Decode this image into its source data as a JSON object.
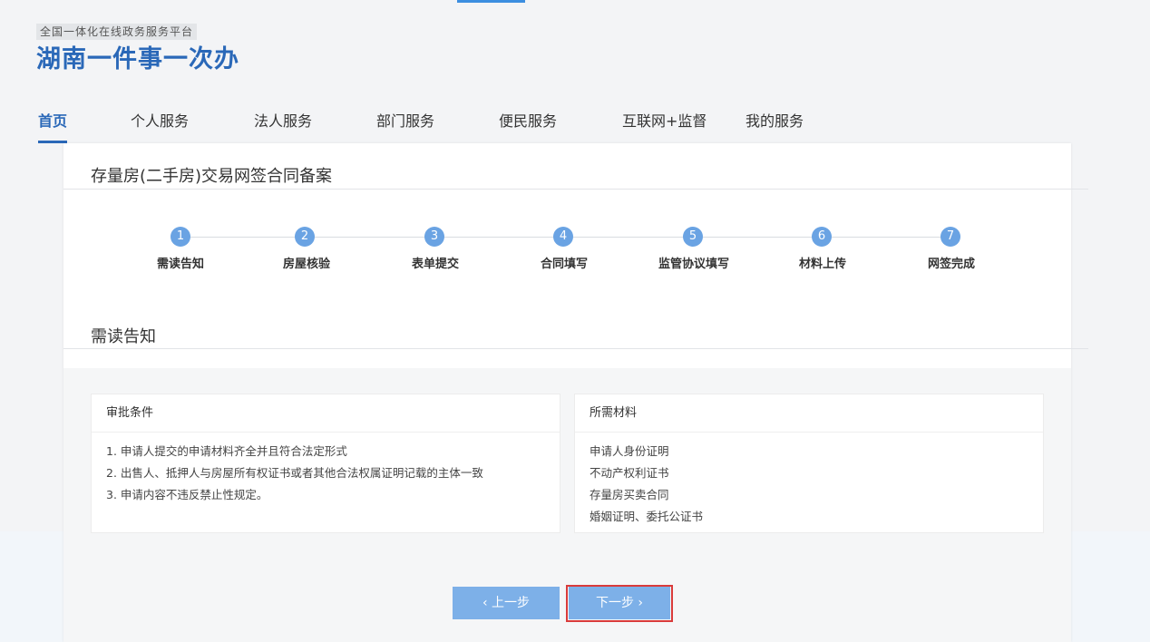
{
  "header": {
    "subtitle": "全国一体化在线政务服务平台",
    "title": "湖南一件事一次办"
  },
  "nav": {
    "items": [
      {
        "label": "首页",
        "active": true
      },
      {
        "label": "个人服务"
      },
      {
        "label": "法人服务"
      },
      {
        "label": "部门服务"
      },
      {
        "label": "便民服务"
      },
      {
        "label": "互联网+监督"
      },
      {
        "label": "我的服务"
      }
    ]
  },
  "page": {
    "title": "存量房(二手房)交易网签合同备案",
    "section_title": "需读告知"
  },
  "steps": [
    {
      "number": "1",
      "label": "需读告知"
    },
    {
      "number": "2",
      "label": "房屋核验"
    },
    {
      "number": "3",
      "label": "表单提交"
    },
    {
      "number": "4",
      "label": "合同填写"
    },
    {
      "number": "5",
      "label": "监管协议填写"
    },
    {
      "number": "6",
      "label": "材料上传"
    },
    {
      "number": "7",
      "label": "网签完成"
    }
  ],
  "conditions": {
    "title": "审批条件",
    "lines": [
      "1. 申请人提交的申请材料齐全并且符合法定形式",
      "2. 出售人、抵押人与房屋所有权证书或者其他合法权属证明记载的主体一致",
      "3. 申请内容不违反禁止性规定。"
    ]
  },
  "materials": {
    "title": "所需材料",
    "lines": [
      "申请人身份证明",
      "不动产权利证书",
      "存量房买卖合同",
      "婚姻证明、委托公证书"
    ]
  },
  "buttons": {
    "prev": "‹  上一步",
    "next": "下一步  ›"
  },
  "colors": {
    "brand": "#2a68b8",
    "step": "#6aa3e3",
    "button": "#7db0e8",
    "highlight": "#d93b3b"
  }
}
